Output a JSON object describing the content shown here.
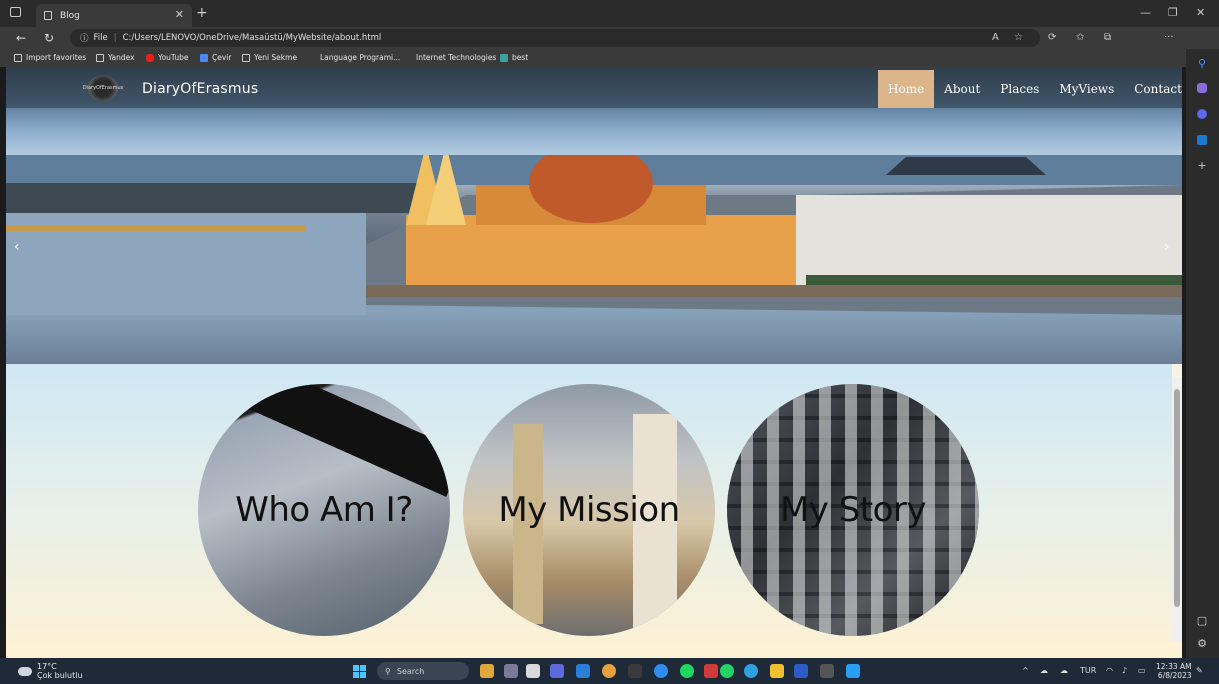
{
  "browser": {
    "tab_title": "Blog",
    "url_scheme": "File",
    "url": "C:/Users/LENOVO/OneDrive/Masaüstü/MyWebsite/about.html"
  },
  "favorites": [
    {
      "label": "Import favorites",
      "icon": "import-icon"
    },
    {
      "label": "Yandex",
      "icon": "page-icon"
    },
    {
      "label": "YouTube",
      "icon": "youtube-icon"
    },
    {
      "label": "Çevir",
      "icon": "translate-icon"
    },
    {
      "label": "Yeni Sekme",
      "icon": "page-icon"
    },
    {
      "label": "Language Programi...",
      "icon": "none"
    },
    {
      "label": "Internet Technologies",
      "icon": "none"
    },
    {
      "label": "best",
      "icon": "folder-icon"
    }
  ],
  "site": {
    "brand": "DiaryOfErasmus",
    "logo_text": "DiaryOfErasmus",
    "menu": [
      {
        "label": "Home",
        "active": true
      },
      {
        "label": "About",
        "active": false
      },
      {
        "label": "Places",
        "active": false
      },
      {
        "label": "MyViews",
        "active": false
      },
      {
        "label": "Contact",
        "active": false
      }
    ],
    "cards": [
      {
        "caption": "Who Am I?"
      },
      {
        "caption": "My Mission"
      },
      {
        "caption": "My Story"
      }
    ],
    "colors": {
      "active_menu": "#dcb58a"
    }
  },
  "taskbar": {
    "weather_temp": "17°C",
    "weather_desc": "Çok bulutlu",
    "search_label": "Search",
    "language": "TUR",
    "time": "12:33 AM",
    "date": "6/8/2023"
  }
}
